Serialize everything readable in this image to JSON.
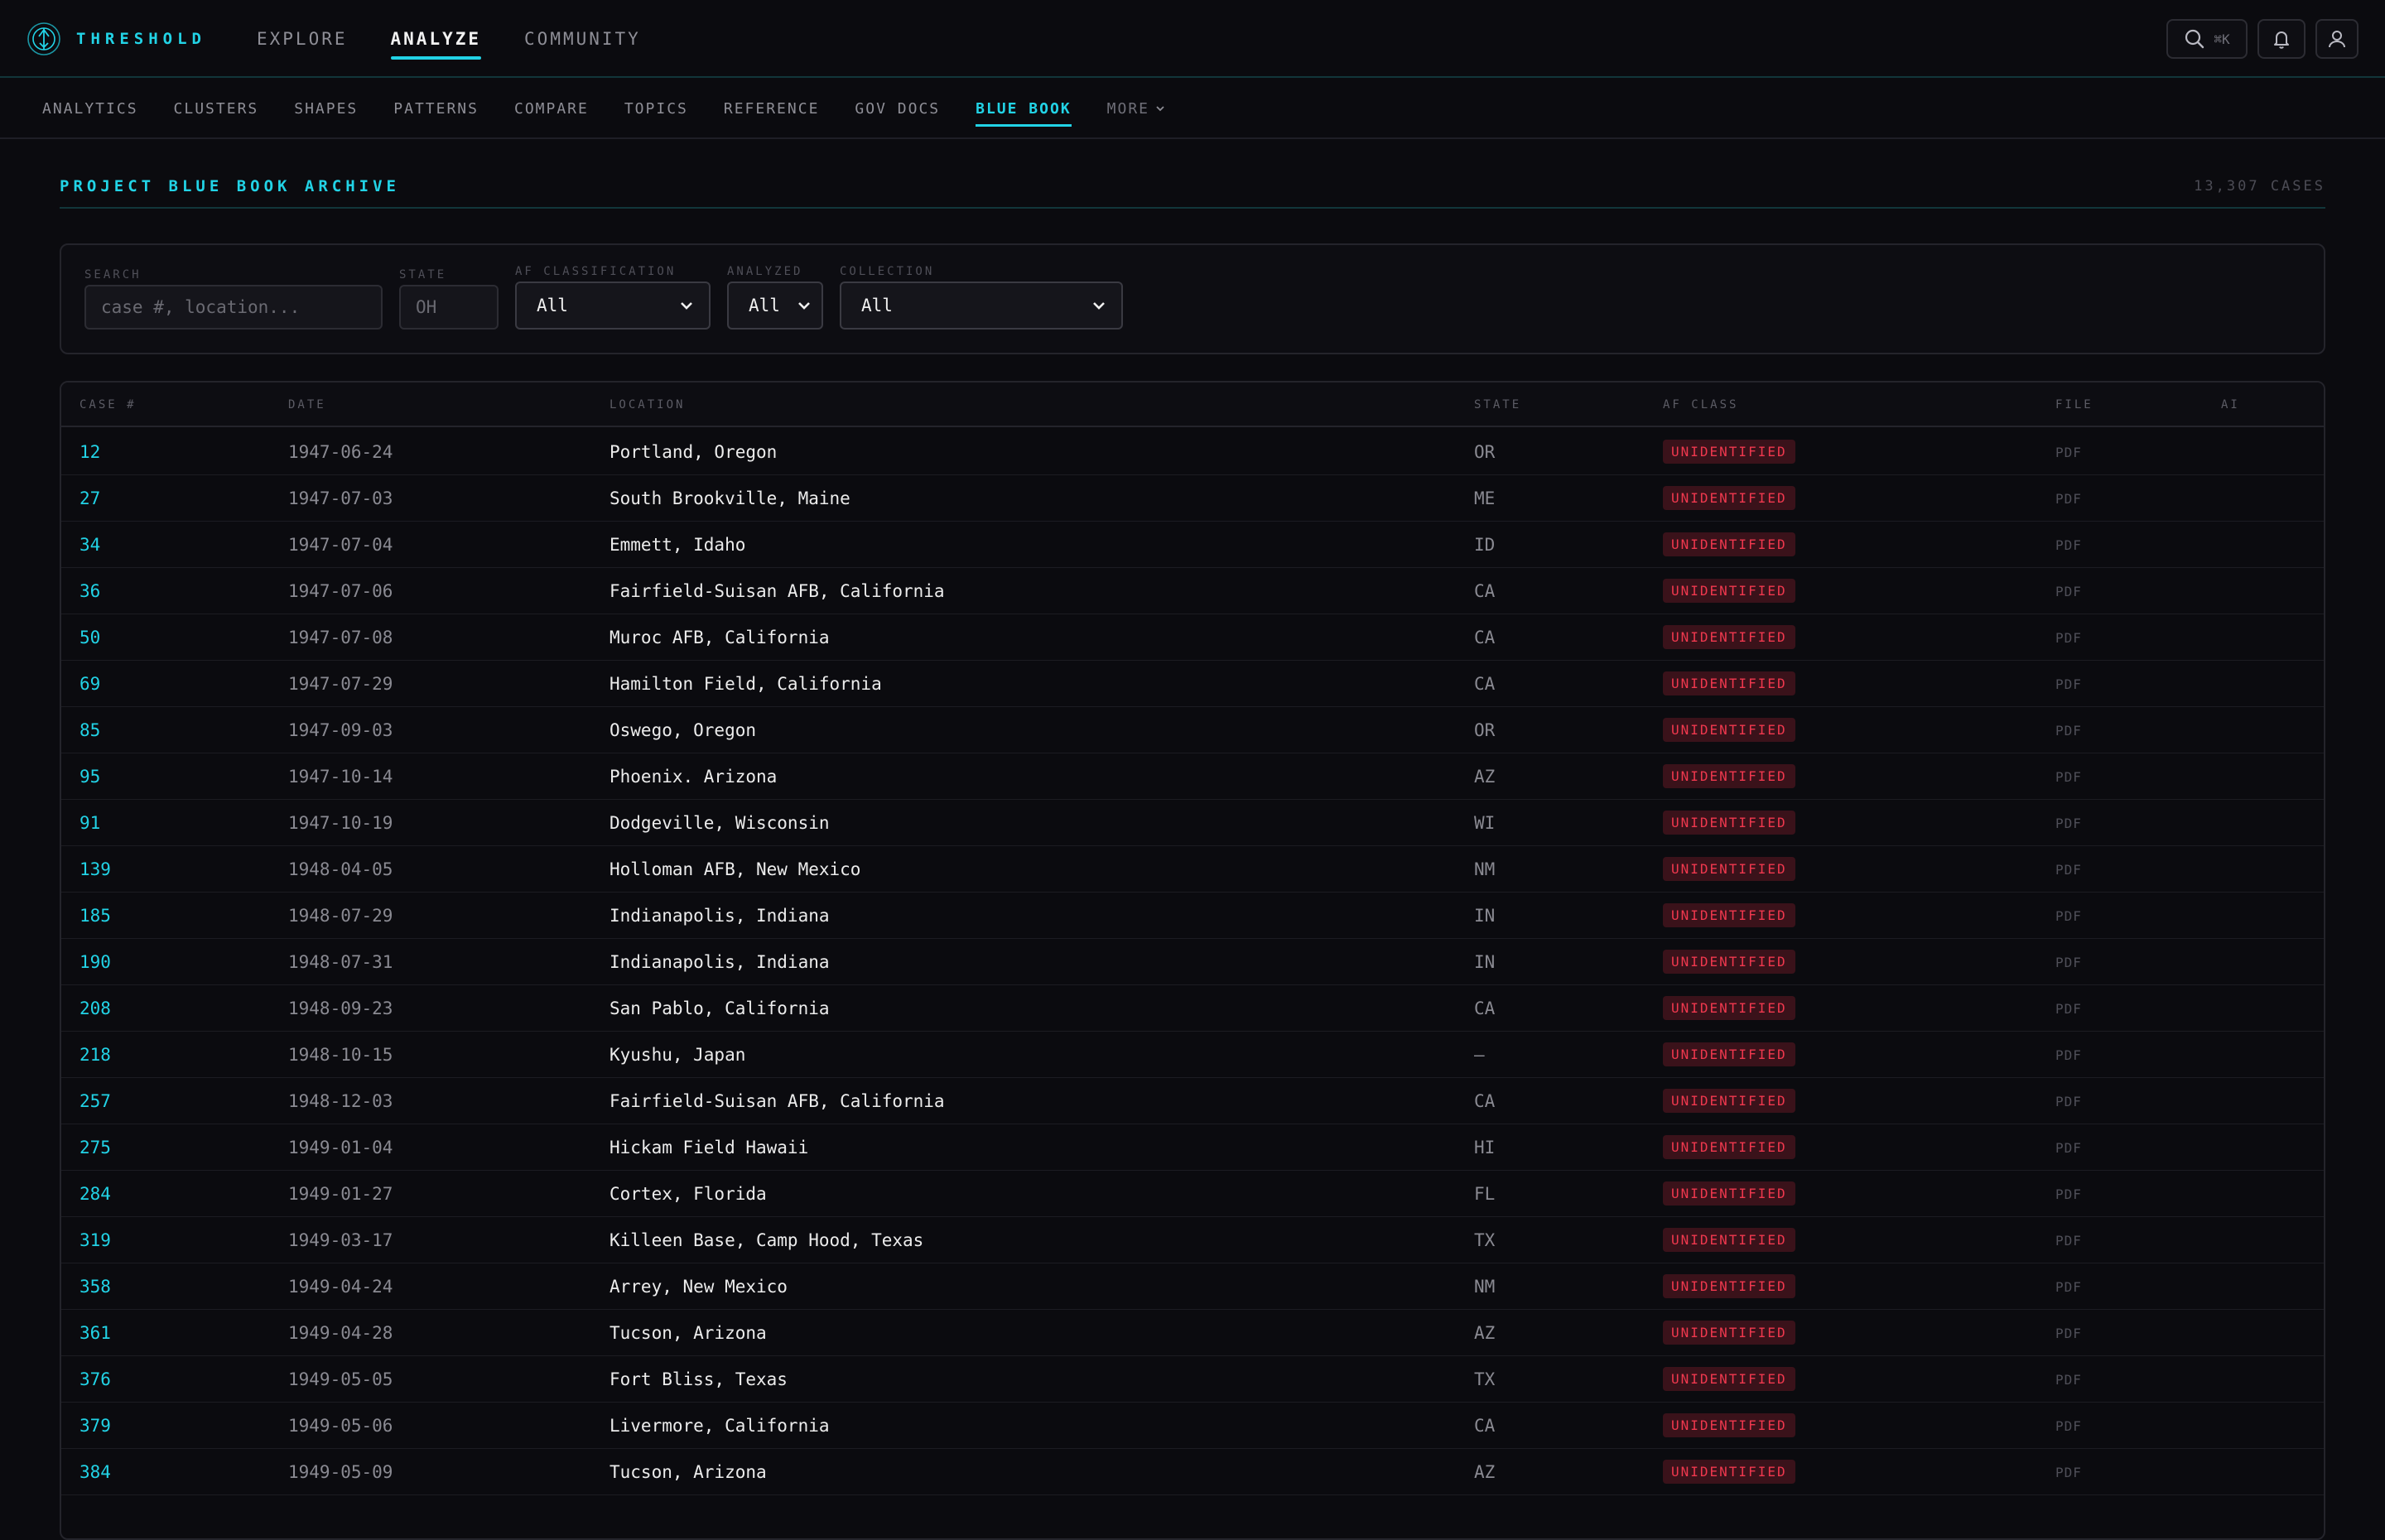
{
  "brand": {
    "name": "THRESHOLD",
    "accent": "#22d3e6"
  },
  "main_nav": [
    {
      "label": "EXPLORE",
      "active": false
    },
    {
      "label": "ANALYZE",
      "active": true
    },
    {
      "label": "COMMUNITY",
      "active": false
    }
  ],
  "top_actions": {
    "search_shortcut": "⌘K"
  },
  "sub_nav": {
    "items": [
      {
        "label": "ANALYTICS",
        "active": false
      },
      {
        "label": "CLUSTERS",
        "active": false
      },
      {
        "label": "SHAPES",
        "active": false
      },
      {
        "label": "PATTERNS",
        "active": false
      },
      {
        "label": "COMPARE",
        "active": false
      },
      {
        "label": "TOPICS",
        "active": false
      },
      {
        "label": "REFERENCE",
        "active": false
      },
      {
        "label": "GOV DOCS",
        "active": false
      },
      {
        "label": "BLUE BOOK",
        "active": true
      }
    ],
    "more_label": "MORE"
  },
  "section": {
    "title": "PROJECT BLUE BOOK ARCHIVE",
    "count": "13,307 CASES"
  },
  "filters": {
    "search": {
      "label": "SEARCH",
      "placeholder": "case #, location..."
    },
    "state": {
      "label": "STATE",
      "placeholder": "OH"
    },
    "af_classification": {
      "label": "AF CLASSIFICATION",
      "value": "All"
    },
    "analyzed": {
      "label": "ANALYZED",
      "value": "All"
    },
    "collection": {
      "label": "COLLECTION",
      "value": "All"
    }
  },
  "table": {
    "columns": [
      "CASE #",
      "DATE",
      "LOCATION",
      "STATE",
      "AF CLASS",
      "FILE",
      "AI"
    ],
    "rows": [
      {
        "case": "12",
        "date": "1947-06-24",
        "location": "Portland, Oregon",
        "state": "OR",
        "af_class": "UNIDENTIFIED",
        "file": "PDF"
      },
      {
        "case": "27",
        "date": "1947-07-03",
        "location": "South Brookville, Maine",
        "state": "ME",
        "af_class": "UNIDENTIFIED",
        "file": "PDF"
      },
      {
        "case": "34",
        "date": "1947-07-04",
        "location": "Emmett, Idaho",
        "state": "ID",
        "af_class": "UNIDENTIFIED",
        "file": "PDF"
      },
      {
        "case": "36",
        "date": "1947-07-06",
        "location": "Fairfield-Suisan AFB, California",
        "state": "CA",
        "af_class": "UNIDENTIFIED",
        "file": "PDF"
      },
      {
        "case": "50",
        "date": "1947-07-08",
        "location": "Muroc AFB, California",
        "state": "CA",
        "af_class": "UNIDENTIFIED",
        "file": "PDF"
      },
      {
        "case": "69",
        "date": "1947-07-29",
        "location": "Hamilton Field, California",
        "state": "CA",
        "af_class": "UNIDENTIFIED",
        "file": "PDF"
      },
      {
        "case": "85",
        "date": "1947-09-03",
        "location": "Oswego, Oregon",
        "state": "OR",
        "af_class": "UNIDENTIFIED",
        "file": "PDF"
      },
      {
        "case": "95",
        "date": "1947-10-14",
        "location": "Phoenix. Arizona",
        "state": "AZ",
        "af_class": "UNIDENTIFIED",
        "file": "PDF"
      },
      {
        "case": "91",
        "date": "1947-10-19",
        "location": "Dodgeville, Wisconsin",
        "state": "WI",
        "af_class": "UNIDENTIFIED",
        "file": "PDF"
      },
      {
        "case": "139",
        "date": "1948-04-05",
        "location": "Holloman AFB, New Mexico",
        "state": "NM",
        "af_class": "UNIDENTIFIED",
        "file": "PDF"
      },
      {
        "case": "185",
        "date": "1948-07-29",
        "location": "Indianapolis, Indiana",
        "state": "IN",
        "af_class": "UNIDENTIFIED",
        "file": "PDF"
      },
      {
        "case": "190",
        "date": "1948-07-31",
        "location": "Indianapolis, Indiana",
        "state": "IN",
        "af_class": "UNIDENTIFIED",
        "file": "PDF"
      },
      {
        "case": "208",
        "date": "1948-09-23",
        "location": "San Pablo, California",
        "state": "CA",
        "af_class": "UNIDENTIFIED",
        "file": "PDF"
      },
      {
        "case": "218",
        "date": "1948-10-15",
        "location": "Kyushu, Japan",
        "state": "—",
        "af_class": "UNIDENTIFIED",
        "file": "PDF"
      },
      {
        "case": "257",
        "date": "1948-12-03",
        "location": "Fairfield-Suisan AFB, California",
        "state": "CA",
        "af_class": "UNIDENTIFIED",
        "file": "PDF"
      },
      {
        "case": "275",
        "date": "1949-01-04",
        "location": "Hickam Field Hawaii",
        "state": "HI",
        "af_class": "UNIDENTIFIED",
        "file": "PDF"
      },
      {
        "case": "284",
        "date": "1949-01-27",
        "location": "Cortex, Florida",
        "state": "FL",
        "af_class": "UNIDENTIFIED",
        "file": "PDF"
      },
      {
        "case": "319",
        "date": "1949-03-17",
        "location": "Killeen Base, Camp Hood, Texas",
        "state": "TX",
        "af_class": "UNIDENTIFIED",
        "file": "PDF"
      },
      {
        "case": "358",
        "date": "1949-04-24",
        "location": "Arrey, New Mexico",
        "state": "NM",
        "af_class": "UNIDENTIFIED",
        "file": "PDF"
      },
      {
        "case": "361",
        "date": "1949-04-28",
        "location": "Tucson, Arizona",
        "state": "AZ",
        "af_class": "UNIDENTIFIED",
        "file": "PDF"
      },
      {
        "case": "376",
        "date": "1949-05-05",
        "location": "Fort Bliss, Texas",
        "state": "TX",
        "af_class": "UNIDENTIFIED",
        "file": "PDF"
      },
      {
        "case": "379",
        "date": "1949-05-06",
        "location": "Livermore, California",
        "state": "CA",
        "af_class": "UNIDENTIFIED",
        "file": "PDF"
      },
      {
        "case": "384",
        "date": "1949-05-09",
        "location": "Tucson, Arizona",
        "state": "AZ",
        "af_class": "UNIDENTIFIED",
        "file": "PDF"
      }
    ]
  },
  "colors": {
    "accent": "#22d3e6",
    "badge_text": "#f0384e",
    "badge_bg": "#3a121a",
    "background": "#0b0b0f"
  }
}
